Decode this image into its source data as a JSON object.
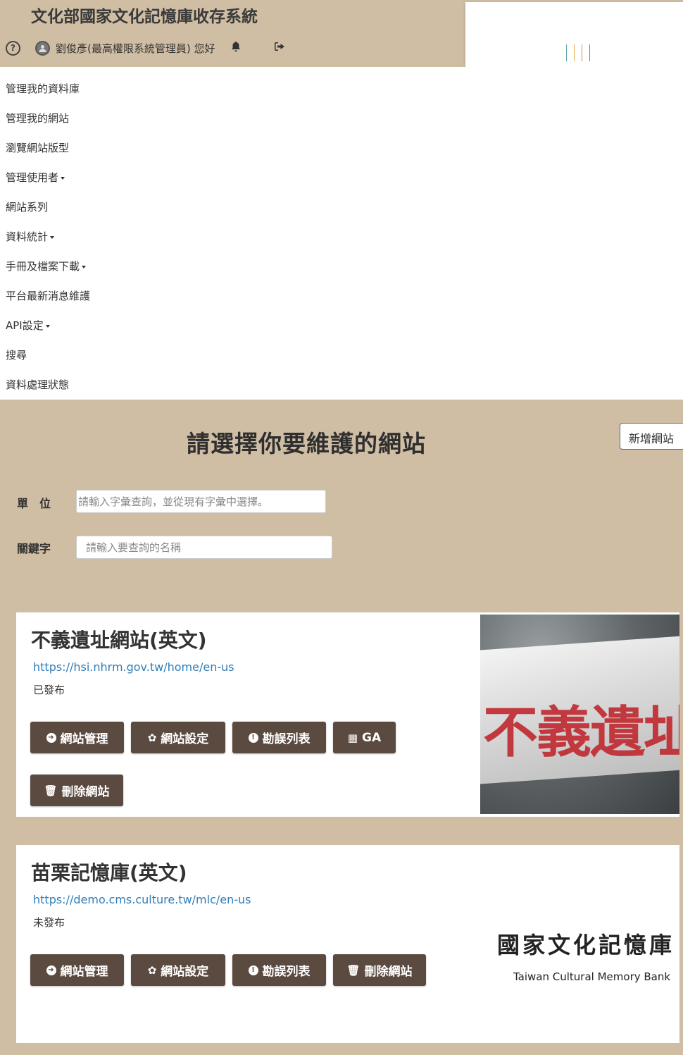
{
  "header": {
    "app_title": "文化部國家文化記憶庫收存系統",
    "user_greeting": "劉俊彥(最高權限系統管理員) 您好"
  },
  "logo": {
    "bar_colors": [
      "#5aa6a1",
      "#e0b040",
      "#d98a3a",
      "#4a8fc4"
    ]
  },
  "nav": {
    "items": [
      {
        "label": "管理我的資料庫",
        "dropdown": false
      },
      {
        "label": "管理我的網站",
        "dropdown": false
      },
      {
        "label": "瀏覽網站版型",
        "dropdown": false
      },
      {
        "label": "管理使用者",
        "dropdown": true
      },
      {
        "label": "網站系列",
        "dropdown": false
      },
      {
        "label": "資料統計",
        "dropdown": true
      },
      {
        "label": "手冊及檔案下載",
        "dropdown": true
      },
      {
        "label": "平台最新消息維護",
        "dropdown": false
      },
      {
        "label": "API設定",
        "dropdown": true
      },
      {
        "label": "搜尋",
        "dropdown": false
      },
      {
        "label": "資料處理狀態",
        "dropdown": false
      }
    ]
  },
  "main": {
    "title": "請選擇你要維護的網站",
    "add_site_label": "新增網站",
    "filters": {
      "unit_label": "單　位",
      "unit_placeholder": "請輸入字彙查詢，並從現有字彙中選擇。",
      "keyword_label": "關鍵字",
      "keyword_placeholder": "請輸入要查詢的名稱"
    },
    "sites": [
      {
        "title": "不義遺址網站(英文)",
        "url": "https://hsi.nhrm.gov.tw/home/en-us",
        "status": "已發布",
        "btn_manage": "網站管理",
        "btn_settings": "網站設定",
        "btn_errata": "勘誤列表",
        "btn_ga": "GA",
        "btn_delete": "刪除網站",
        "image_text": "不義遺址"
      },
      {
        "title": "苗栗記憶庫(英文)",
        "url": "https://demo.cms.culture.tw/mlc/en-us",
        "status": "未發布",
        "btn_manage": "網站管理",
        "btn_settings": "網站設定",
        "btn_errata": "勘誤列表",
        "btn_delete": "刪除網站",
        "brand_zh": "國家文化記憶庫",
        "brand_en": "Taiwan Cultural Memory Bank"
      }
    ]
  }
}
